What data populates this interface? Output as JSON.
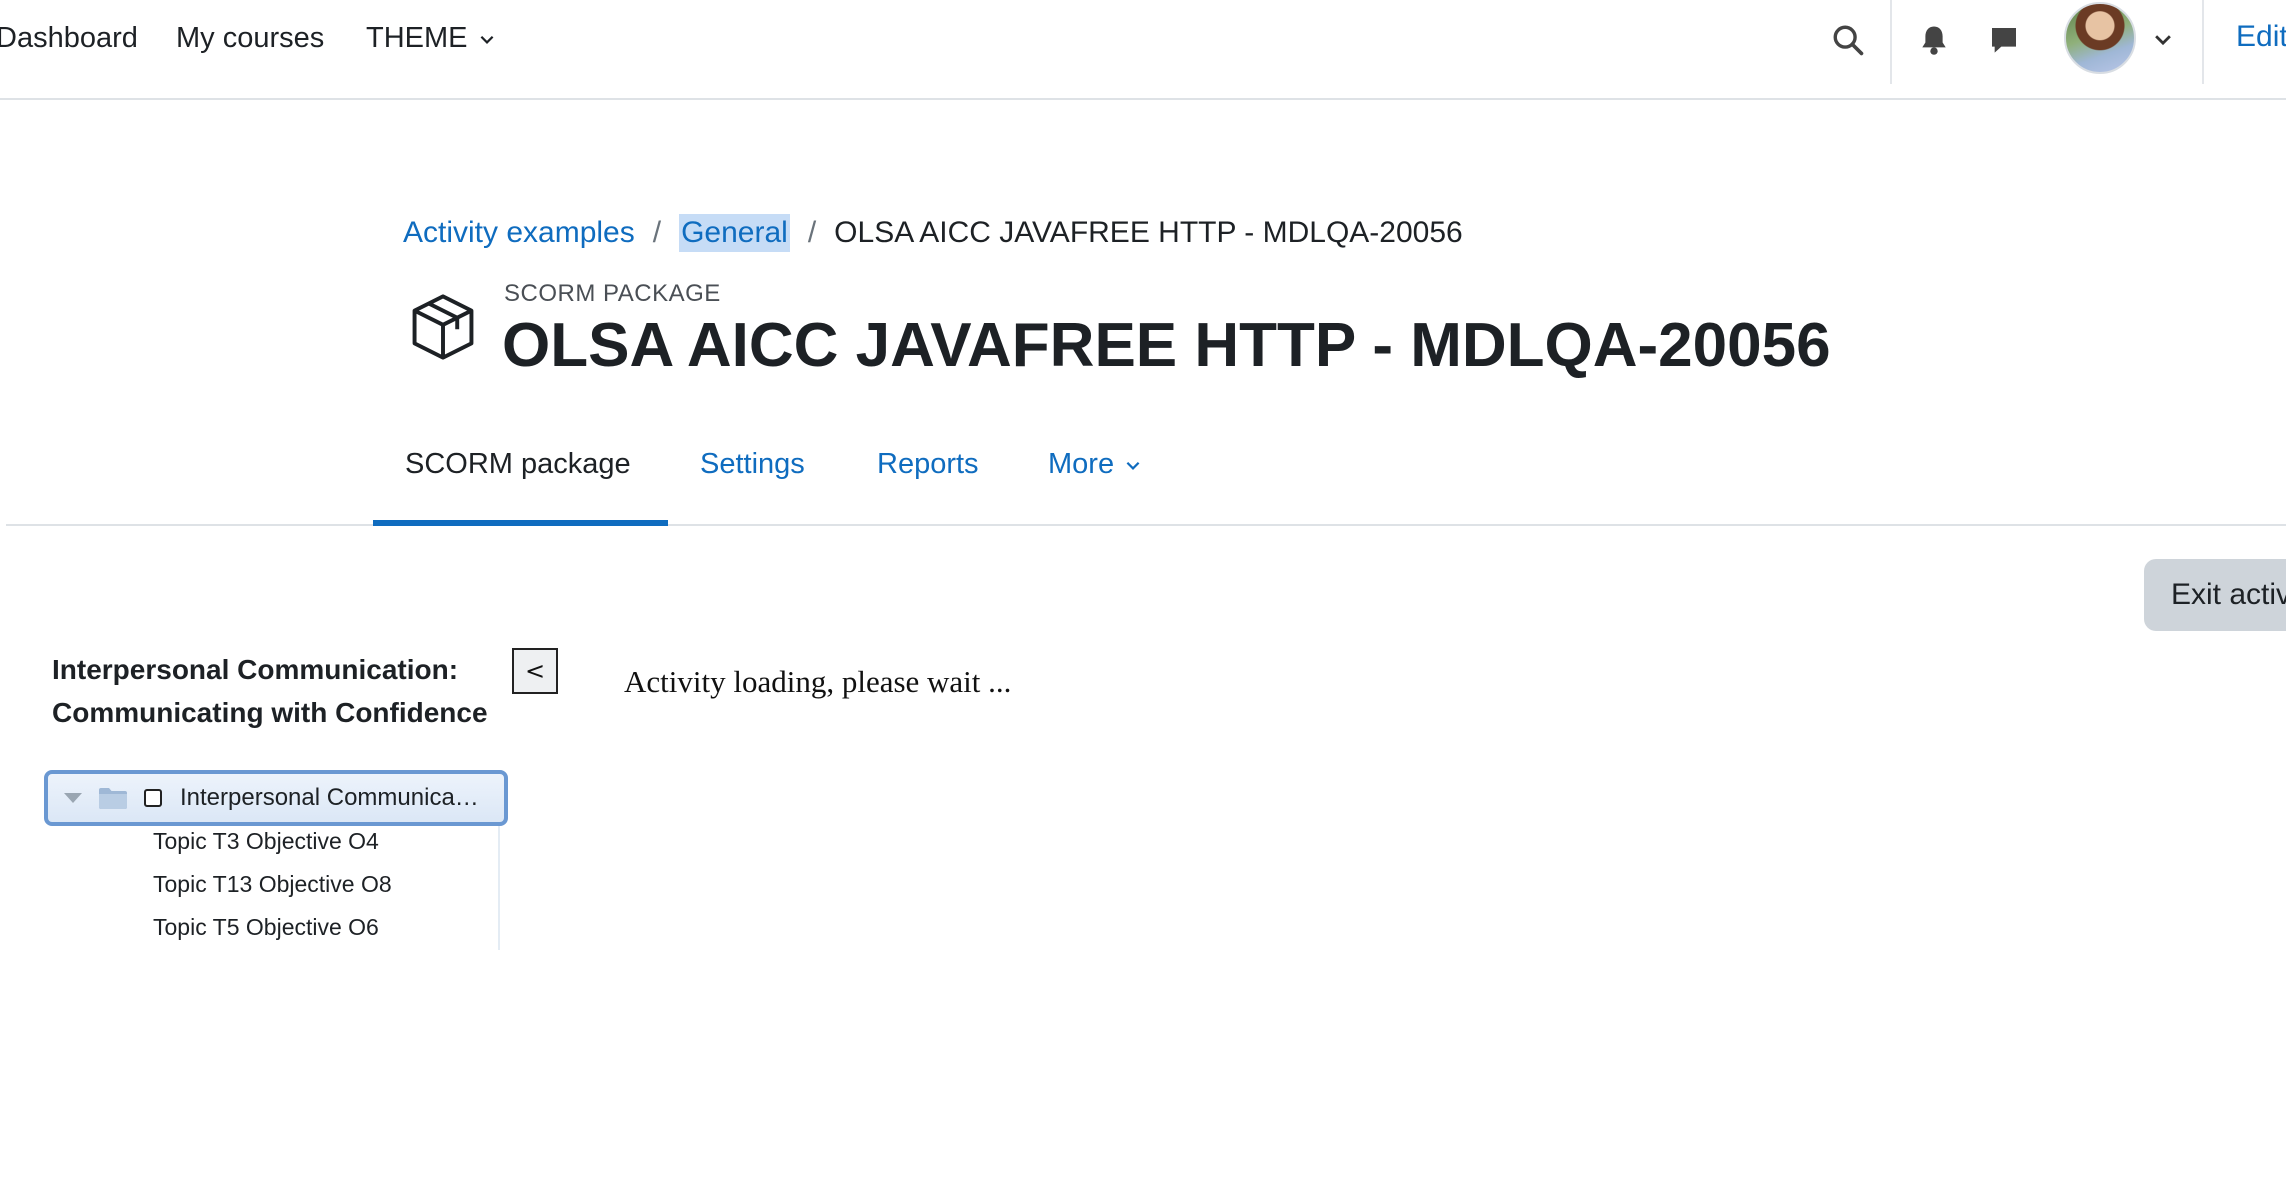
{
  "navbar": {
    "dashboard": "Dashboard",
    "my_courses": "My courses",
    "theme": "THEME",
    "edit": "Edit"
  },
  "breadcrumb": {
    "items": [
      "Activity examples",
      "General",
      "OLSA AICC JAVAFREE HTTP - MDLQA-20056"
    ],
    "separator": "/"
  },
  "header": {
    "pre_title": "SCORM PACKAGE",
    "title": "OLSA AICC JAVAFREE HTTP - MDLQA-20056"
  },
  "tabs": [
    {
      "label": "SCORM package",
      "active": true
    },
    {
      "label": "Settings",
      "active": false
    },
    {
      "label": "Reports",
      "active": false
    },
    {
      "label": "More",
      "active": false
    }
  ],
  "exit_button": "Exit activity",
  "toc": {
    "title": "Interpersonal Communication: Communicating with Confidence",
    "toggle": "<",
    "root": "Interpersonal Communication: Communicating with Confidence",
    "items": [
      "Topic T3 Objective O4",
      "Topic T13 Objective O8",
      "Topic T5 Objective O6"
    ]
  },
  "loading_text": "Activity loading, please wait ...",
  "colors": {
    "link": "#0f6cbf",
    "active_tab_underline": "#0f6cbf",
    "exit_button_bg": "#ced4da",
    "crumb_highlight": "#c6dcf6"
  },
  "icons": [
    "search-icon",
    "bell-icon",
    "chat-icon",
    "chevron-down-icon",
    "package-icon",
    "folder-icon",
    "checkbox-icon"
  ]
}
